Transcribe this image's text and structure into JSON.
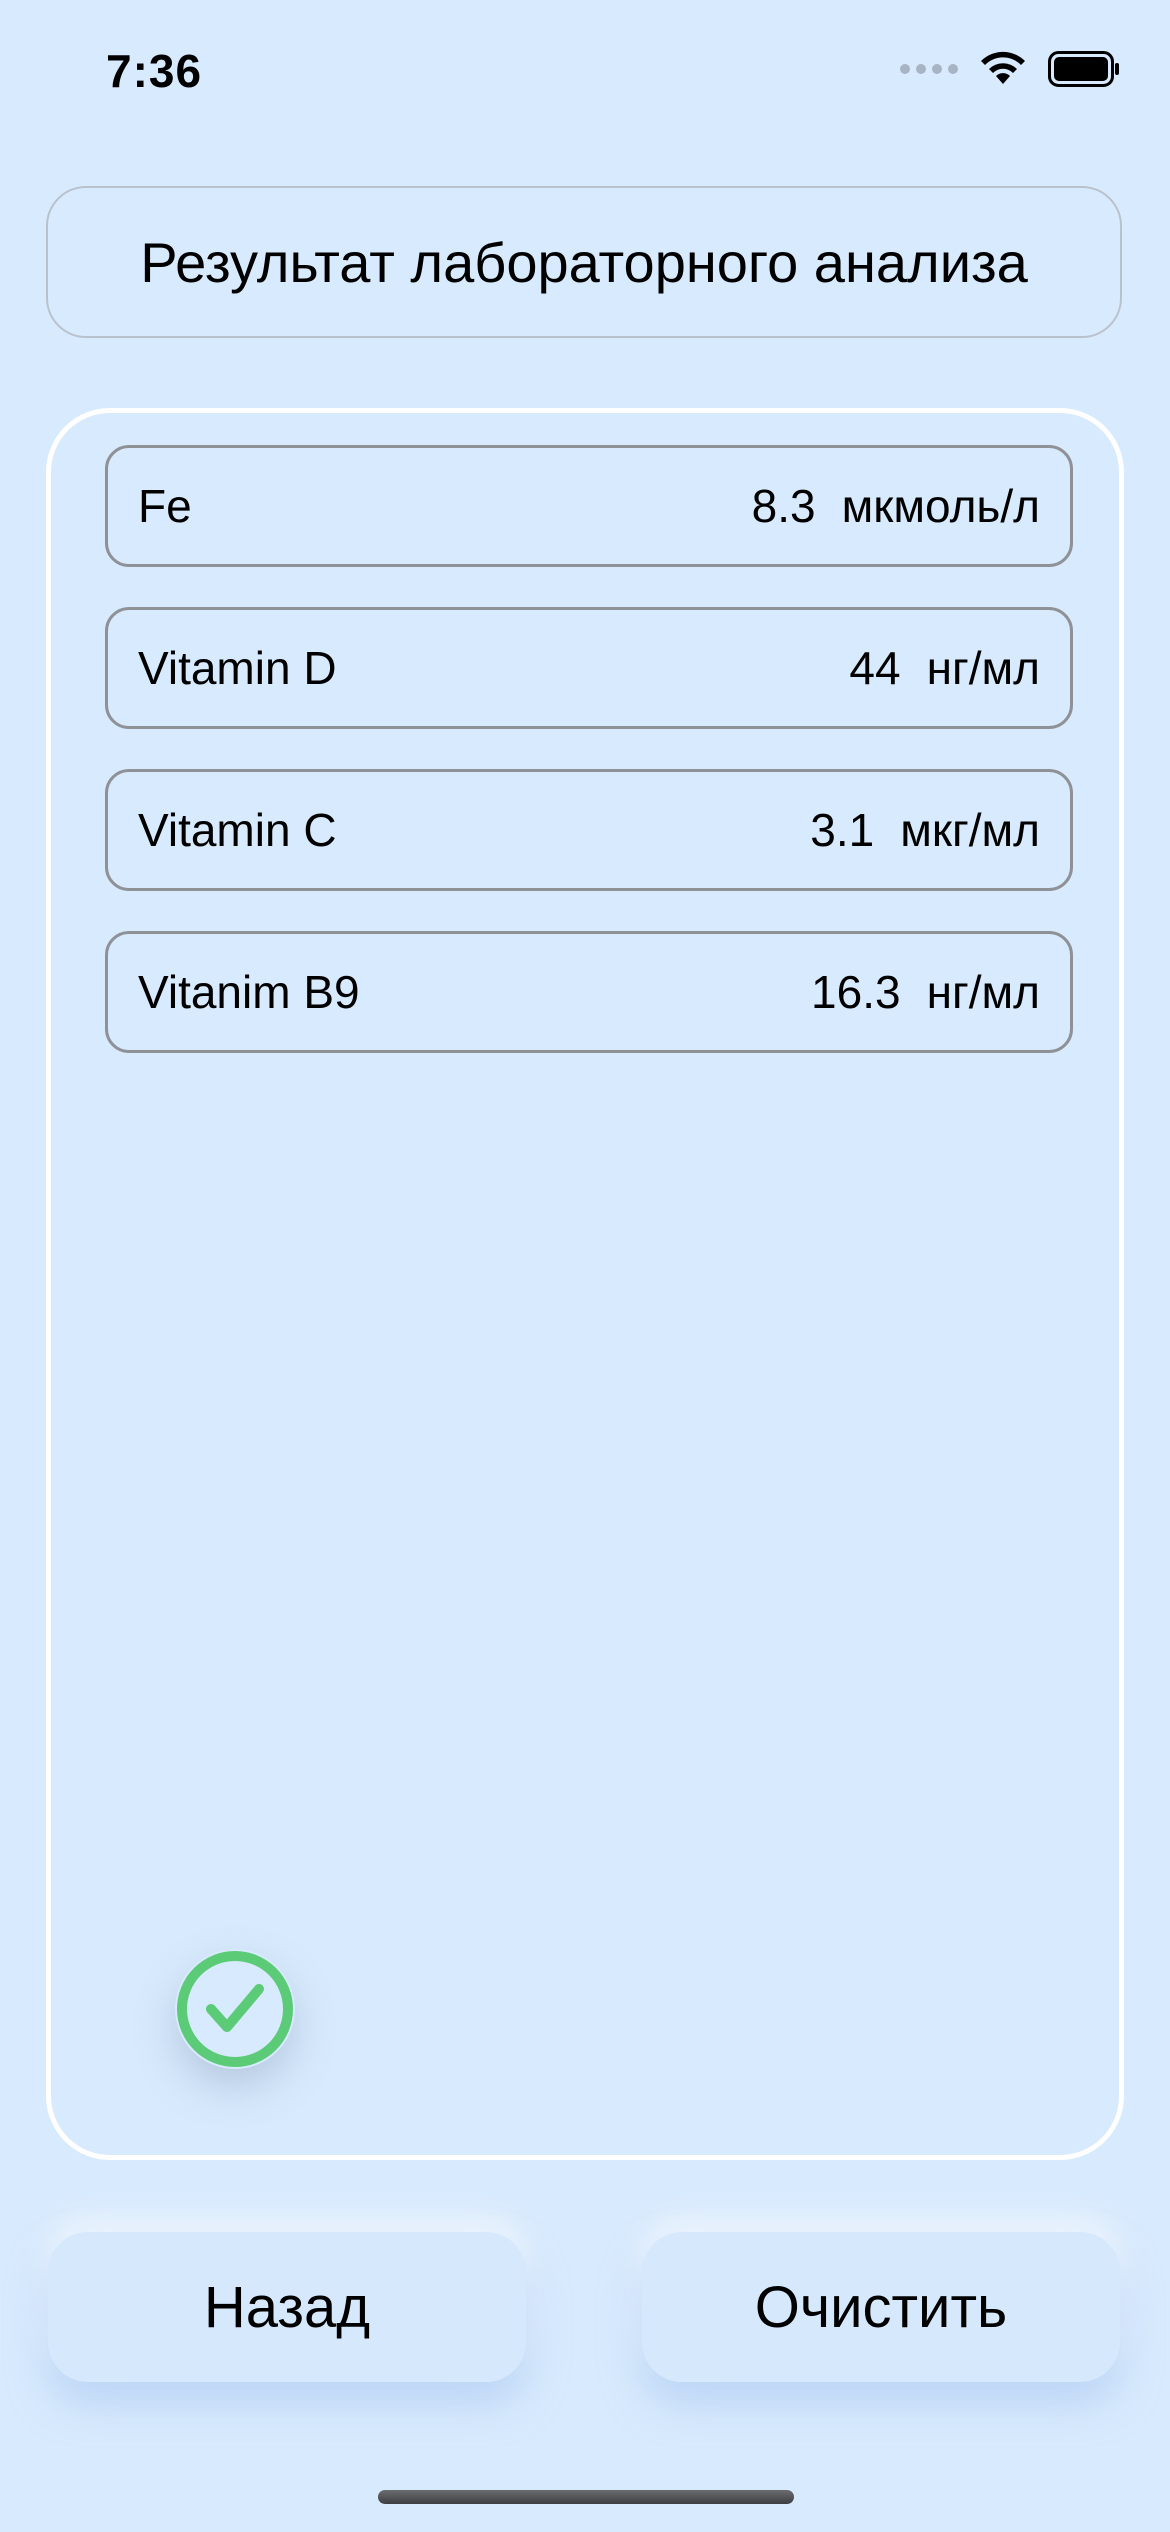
{
  "status_bar": {
    "time": "7:36"
  },
  "header": {
    "title": "Результат лабораторного анализа"
  },
  "results": [
    {
      "name": "Fe",
      "value": "8.3",
      "unit": "мкмоль/л"
    },
    {
      "name": "Vitamin D",
      "value": "44",
      "unit": "нг/мл"
    },
    {
      "name": "Vitamin C",
      "value": "3.1",
      "unit": "мкг/мл"
    },
    {
      "name": "Vitanim B9",
      "value": "16.3",
      "unit": "нг/мл"
    }
  ],
  "status_icon": "check-circle-icon",
  "buttons": {
    "back_label": "Назад",
    "clear_label": "Очистить"
  },
  "colors": {
    "background": "#d8eafd",
    "check_green": "#5ccb78",
    "row_border": "#8e9196"
  }
}
